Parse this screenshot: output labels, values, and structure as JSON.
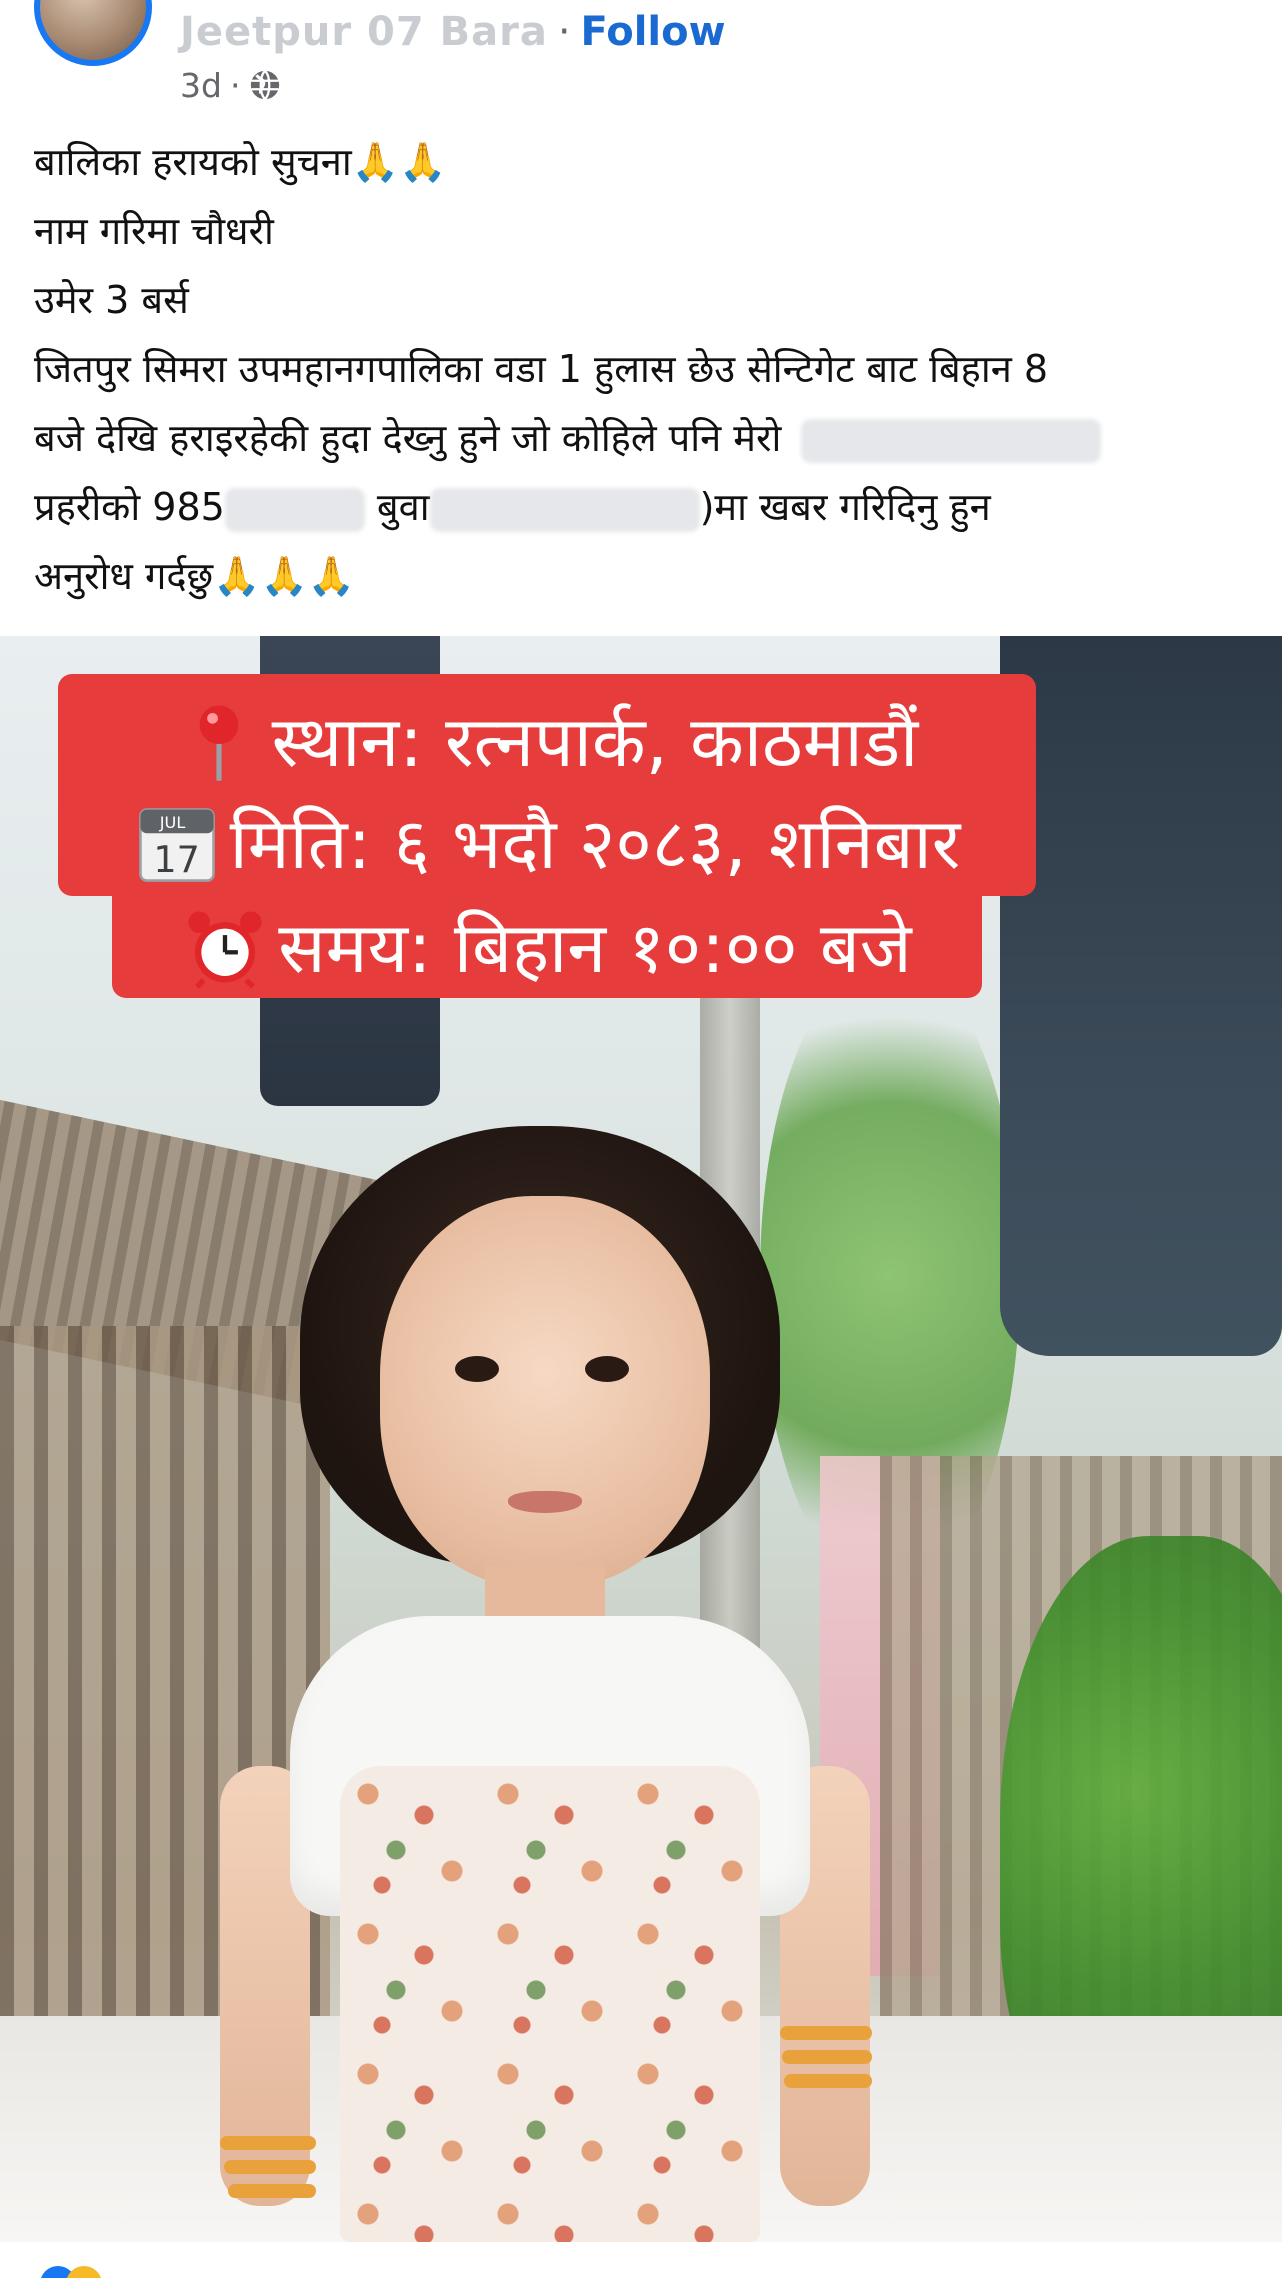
{
  "header": {
    "author_name": "Jeetpur 07 Bara",
    "separator": "·",
    "follow_label": "Follow",
    "time_ago": "3d",
    "meta_separator": "·",
    "audience_icon": "globe-icon"
  },
  "caption": {
    "line1": "बालिका हरायको सुचना🙏🙏",
    "line2": "नाम गरिमा चौधरी",
    "line3": "उमेर 3 बर्स",
    "line4": "जितपुर सिमरा उपमहानगपालिका वडा 1 हुलास छेउ सेन्टिगेट बाट बिहान 8",
    "line5": "बजे देखि हराइरहेकी हुदा देख्नु हुने जो कोहिले पनि मेरो",
    "line6_a": "प्रहरीको 985",
    "line6_b": "बुवा",
    "line6_c": ")मा खबर गरिदिनु हुन",
    "line7": "अनुरोध गर्दछु🙏🙏🙏"
  },
  "banner": {
    "line1_icon": "round-pushpin-icon",
    "line1_text": "स्थान: रत्नपार्क, काठमाडौं",
    "line2_icon": "calendar-icon",
    "line2_calendar_month": "JUL",
    "line2_calendar_day": "17",
    "line2_text": "मिति: ६ भदौ २०८३, शनिबार",
    "line3_icon": "alarm-clock-icon",
    "line3_text": "समय: बिहान १०:०० बजे",
    "background_color": "#e63c3c",
    "text_color": "#ffffff"
  },
  "colors": {
    "follow_blue": "#1b6ad1",
    "avatar_ring": "#1877f2",
    "meta_gray": "#65676b"
  }
}
